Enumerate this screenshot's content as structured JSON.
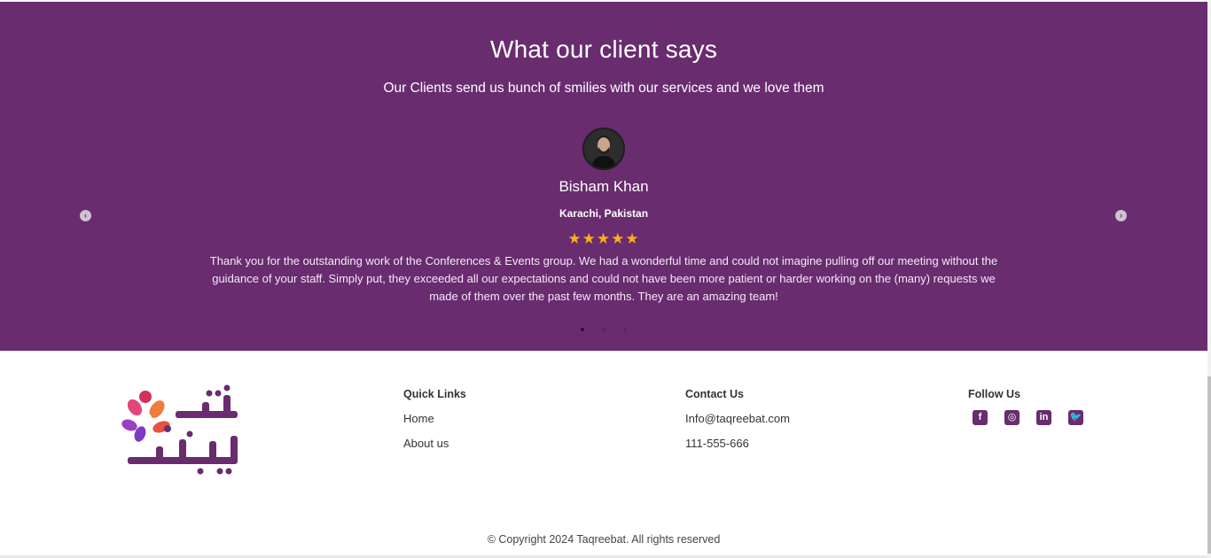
{
  "testimonials": {
    "title": "What our client says",
    "subtitle": "Our Clients send us bunch of smilies with our services and we love them",
    "client_name": "Bisham Khan",
    "client_location": "Karachi, Pakistan",
    "rating": "★★★★★",
    "quote": "Thank you for the outstanding work of the Conferences & Events group. We had a wonderful time and could not imagine pulling off our meeting without the guidance of your staff. Simply put, they exceeded all our expectations and could not have been more patient or harder working on the (many) requests we made of them over the past few months. They are an amazing team!",
    "prev_icon": "chevron-left-icon",
    "next_icon": "chevron-right-icon",
    "prev_glyph": "‹",
    "next_glyph": "›",
    "slides": 3,
    "active_slide": 1
  },
  "footer": {
    "quick_links": {
      "heading": "Quick Links",
      "items": [
        "Home",
        "About us"
      ]
    },
    "contact": {
      "heading": "Contact Us",
      "email": "Info@taqreebat.com",
      "phone": "111-555-666"
    },
    "follow": {
      "heading": "Follow Us",
      "icons": [
        "facebook-icon",
        "instagram-icon",
        "linkedin-icon",
        "twitter-icon"
      ],
      "glyphs": [
        "f",
        "◎",
        "in",
        "🐦"
      ]
    },
    "copyright": "© Copyright 2024 Taqreebat. All rights reserved"
  },
  "colors": {
    "brand_purple": "#682c6f",
    "star": "#f6b01b"
  }
}
